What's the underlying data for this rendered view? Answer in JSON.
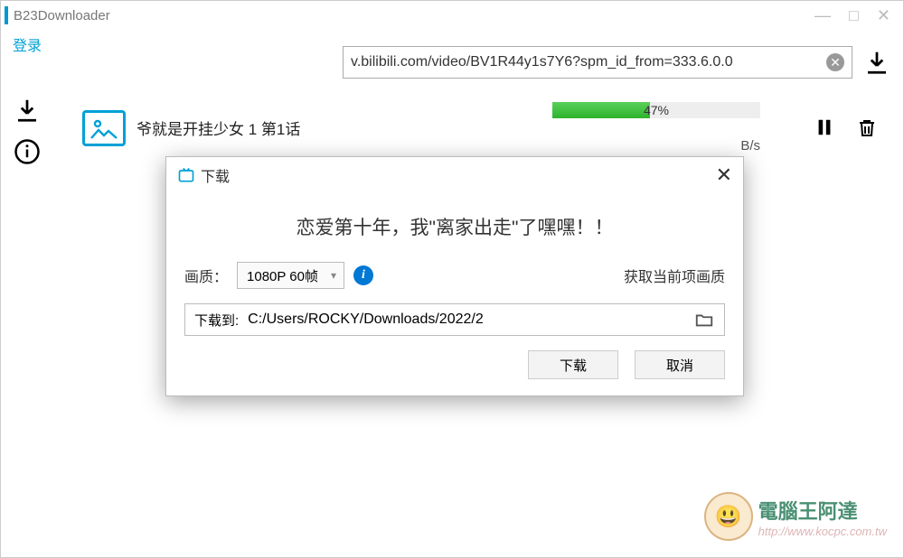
{
  "app": {
    "title": "B23Downloader",
    "login_label": "登录"
  },
  "winctl": {
    "min": "—",
    "max": "□",
    "close": "✕"
  },
  "url": {
    "value": "v.bilibili.com/video/BV1R44y1s7Y6?spm_id_from=333.6.0.0"
  },
  "task": {
    "title": "爷就是开挂少女 1 第1话",
    "progress_pct": 47,
    "progress_label": "47%",
    "speed": "B/s"
  },
  "dialog": {
    "title": "下载",
    "heading": "恋爱第十年，我\"离家出走\"了嘿嘿！！",
    "quality_label": "画质：",
    "quality_value": "1080P 60帧",
    "get_current": "获取当前项画质",
    "path_label": "下载到:",
    "path_value": "C:/Users/ROCKY/Downloads/2022/2",
    "download_btn": "下载",
    "cancel_btn": "取消"
  },
  "watermark": {
    "title": "電腦王阿達",
    "url": "http://www.kocpc.com.tw"
  }
}
